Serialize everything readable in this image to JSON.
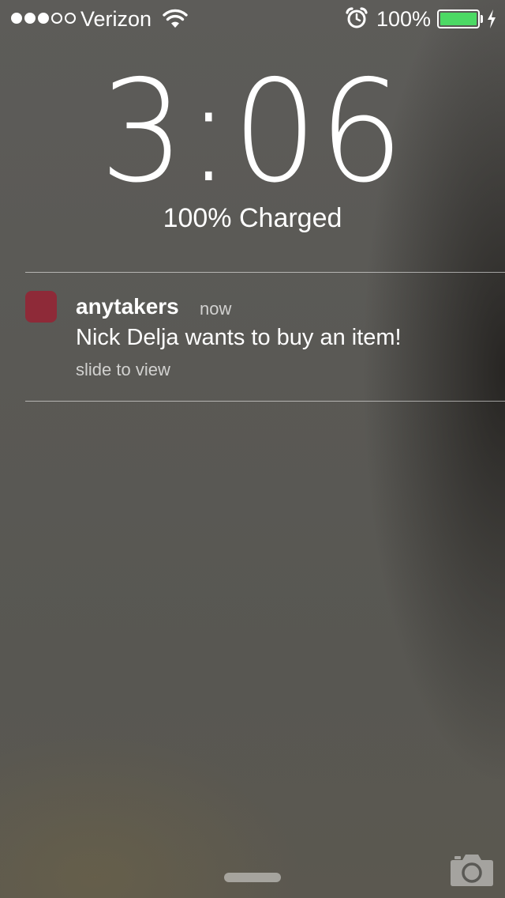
{
  "status_bar": {
    "signal_bars_total": 5,
    "signal_bars_filled": 3,
    "carrier": "Verizon",
    "wifi_icon": "wifi-icon",
    "alarm_icon": "alarm-clock-icon",
    "battery_percent": "100%",
    "battery_level": 1.0,
    "battery_color": "#4cd964",
    "charging_icon": "lightning-bolt-icon"
  },
  "lock_screen": {
    "time": "3:06",
    "charge_status": "100% Charged"
  },
  "notification": {
    "app_icon_color": "#8e2a38",
    "app_name": "anytakers",
    "time": "now",
    "message": "Nick Delja wants to buy an item!",
    "action": "slide to view"
  },
  "bottom": {
    "grabber": "grabber-handle",
    "camera_icon": "camera-icon"
  }
}
